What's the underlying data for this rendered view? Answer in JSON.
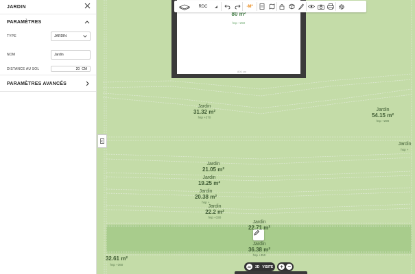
{
  "panel": {
    "title": "JARDIN",
    "params_title": "PARAMÈTRES",
    "type_label": "TYPE",
    "type_value": "JARDIN",
    "nom_label": "NOM",
    "nom_value": "Jardin",
    "distance_label": "DISTANCE AU SOL",
    "distance_value": "20",
    "distance_unit": "CM",
    "advanced_title": "PARAMÈTRES AVANCÉS"
  },
  "toolbar": {
    "floor_label": "RDC",
    "meter_label": "-M²"
  },
  "house": {
    "area": "80 m²",
    "hsp": "hsp +250",
    "dim": "800 cm"
  },
  "rooms": [
    {
      "name": "Jardin",
      "area": "31.32 m²",
      "hsp": "hsp +270"
    },
    {
      "name": "Jardin",
      "area": "54.15 m²",
      "hsp": "hsp +290"
    },
    {
      "name": "Jardin",
      "area": "",
      "hsp": "hsp +"
    },
    {
      "name": "Jardin",
      "area": "21.05 m²",
      "hsp": ""
    },
    {
      "name": "Jardin",
      "area": "19.25 m²",
      "hsp": ""
    },
    {
      "name": "Jardin",
      "area": "20.38 m²",
      "hsp": "hsp +"
    },
    {
      "name": "Jardin",
      "area": "22.2 m²",
      "hsp": "hsp +330"
    },
    {
      "name": "Jardin",
      "area": "22.71 m²",
      "hsp": ""
    },
    {
      "name": "Jardin",
      "area": "36.38 m²",
      "hsp": "hsp +350"
    },
    {
      "name": "",
      "area": "32.61 m²",
      "hsp": "hsp +360"
    }
  ],
  "bottom": {
    "mode_3d": "3D",
    "mode_visite": "VISITE",
    "zoom_in": "+",
    "zoom_out": "−"
  },
  "colors": {
    "garden": "#c4dca8",
    "garden_highlight": "#a8cc8c",
    "wall": "#3a3a3a"
  }
}
